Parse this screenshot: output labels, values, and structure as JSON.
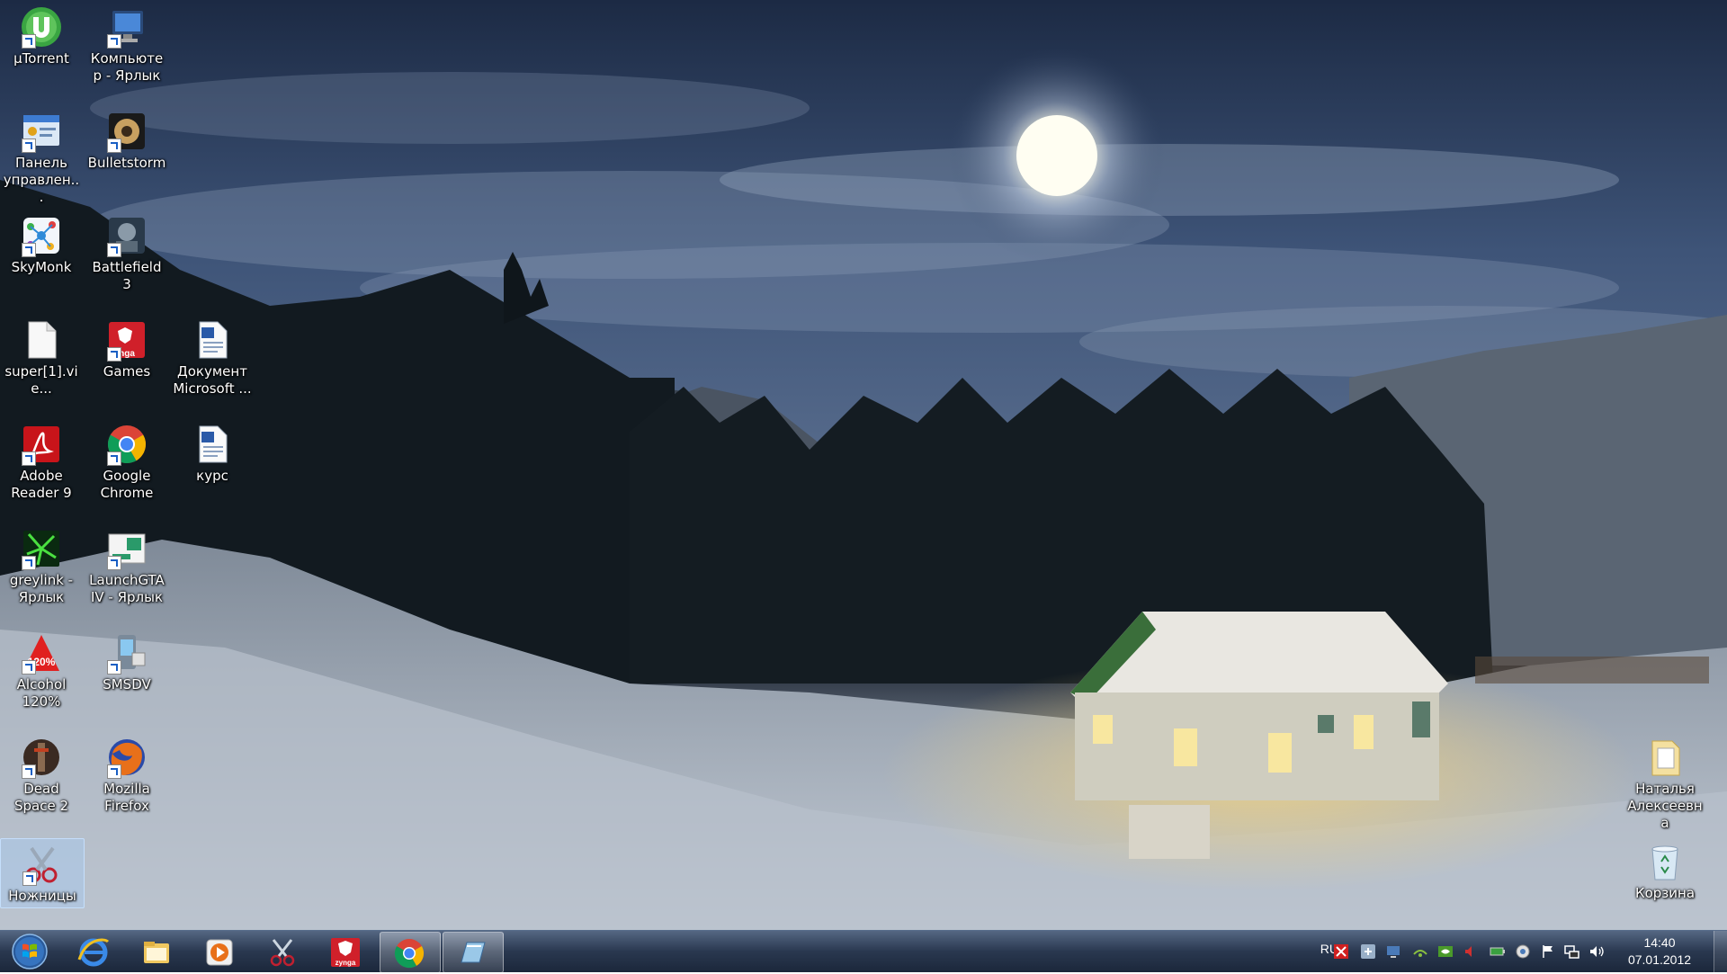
{
  "desktop": {
    "icons": [
      {
        "label": "µTorrent",
        "icon": "utorrent-icon"
      },
      {
        "label": "Компьютер - Ярлык",
        "icon": "computer-icon"
      },
      {
        "label": "Панель управлен...",
        "icon": "control-panel-icon"
      },
      {
        "label": "Bulletstorm",
        "icon": "bulletstorm-icon"
      },
      {
        "label": "SkyMonk",
        "icon": "skymonk-icon"
      },
      {
        "label": "Battlefield 3",
        "icon": "battlefield-icon"
      },
      {
        "label": "super[1].vie...",
        "icon": "file-icon"
      },
      {
        "label": "Games",
        "icon": "zynga-games-icon"
      },
      {
        "label": "Документ Microsoft ...",
        "icon": "word-document-icon"
      },
      {
        "label": "Adobe Reader 9",
        "icon": "adobe-reader-icon"
      },
      {
        "label": "Google Chrome",
        "icon": "chrome-icon"
      },
      {
        "label": "курс",
        "icon": "word-document-icon"
      },
      {
        "label": "greylink - Ярлык",
        "icon": "greylink-icon"
      },
      {
        "label": "LaunchGTAIV - Ярлык",
        "icon": "gtaiv-icon"
      },
      {
        "label": "Alcohol 120%",
        "icon": "alcohol-icon"
      },
      {
        "label": "SMSDV",
        "icon": "smsdv-icon"
      },
      {
        "label": "Dead Space 2",
        "icon": "dead-space-icon"
      },
      {
        "label": "Mozilla Firefox",
        "icon": "firefox-icon"
      },
      {
        "label": "Ножницы",
        "icon": "snipping-tool-icon"
      },
      {
        "label": "Наталья Алексеевна",
        "icon": "folder-icon"
      },
      {
        "label": "Корзина",
        "icon": "recycle-bin-icon"
      }
    ]
  },
  "taskbar": {
    "pinned": [
      "internet-explorer-icon",
      "explorer-folder-icon",
      "media-player-icon",
      "snipping-tool-icon",
      "zynga-icon",
      "chrome-icon",
      "window-icon"
    ],
    "tray": {
      "language": "RU",
      "time": "14:40",
      "date": "07.01.2012"
    }
  }
}
